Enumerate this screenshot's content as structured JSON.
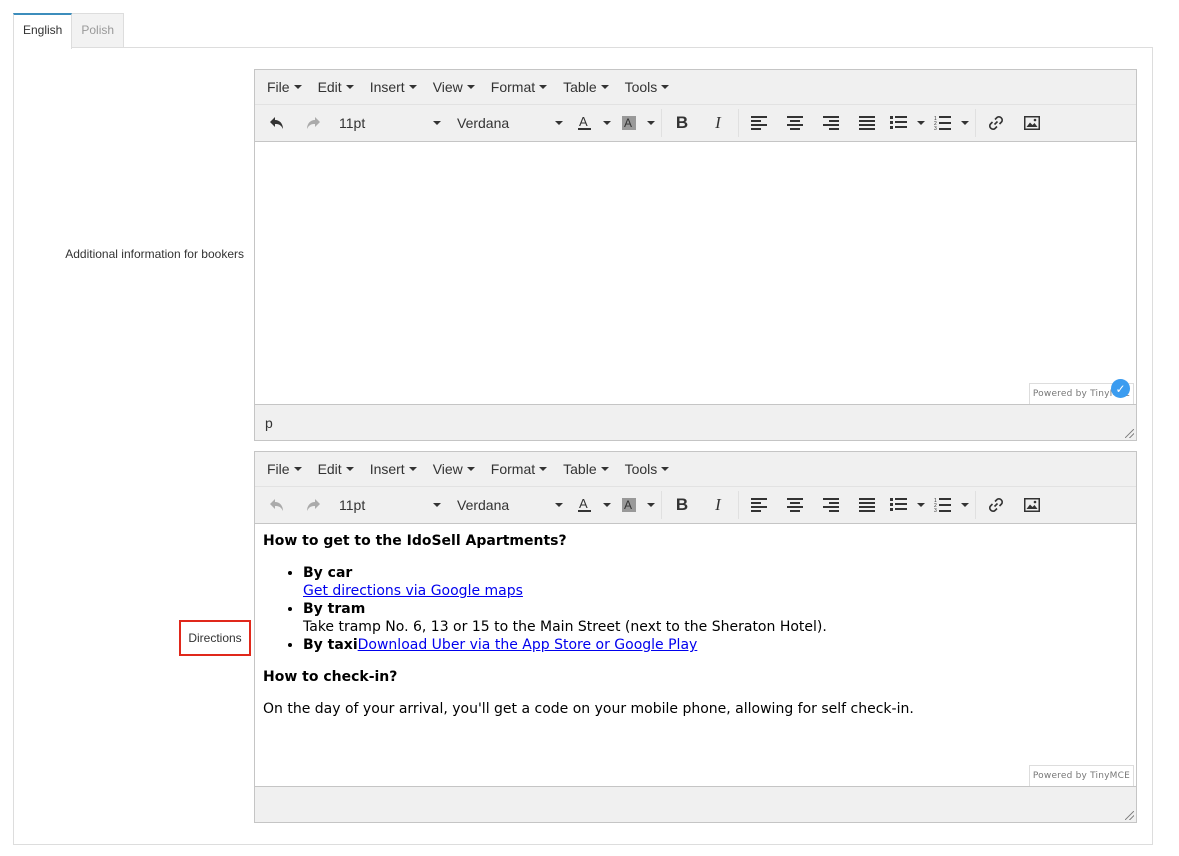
{
  "tabs": [
    {
      "label": "English",
      "active": true
    },
    {
      "label": "Polish",
      "active": false
    }
  ],
  "fields": {
    "additional_info_label": "Additional information for bookers",
    "directions_label": "Directions"
  },
  "editor": {
    "menus": [
      "File",
      "Edit",
      "Insert",
      "View",
      "Format",
      "Table",
      "Tools"
    ],
    "font_size": "11pt",
    "font_family": "Verdana",
    "powered_by": "Powered by TinyMCE",
    "status_path": "p"
  },
  "directions_content": {
    "heading1": "How to get to the IdoSell Apartments?",
    "car_label": "By car",
    "car_link": "Get directions via Google maps",
    "tram_label": "By tram",
    "tram_text": "Take tramp No. 6, 13 or 15 to the Main Street (next to the Sheraton Hotel).",
    "taxi_label": "By taxi",
    "taxi_link": "Download Uber via the App Store or Google Play",
    "heading2": "How to check-in?",
    "checkin_text": "On the day of your arrival, you'll get a code on your mobile phone, allowing for self check-in."
  },
  "colors": {
    "accent_tab": "#3c8dbc",
    "highlight_border": "#e0281b",
    "link": "#0000ee",
    "badge": "#3b9cf0"
  }
}
